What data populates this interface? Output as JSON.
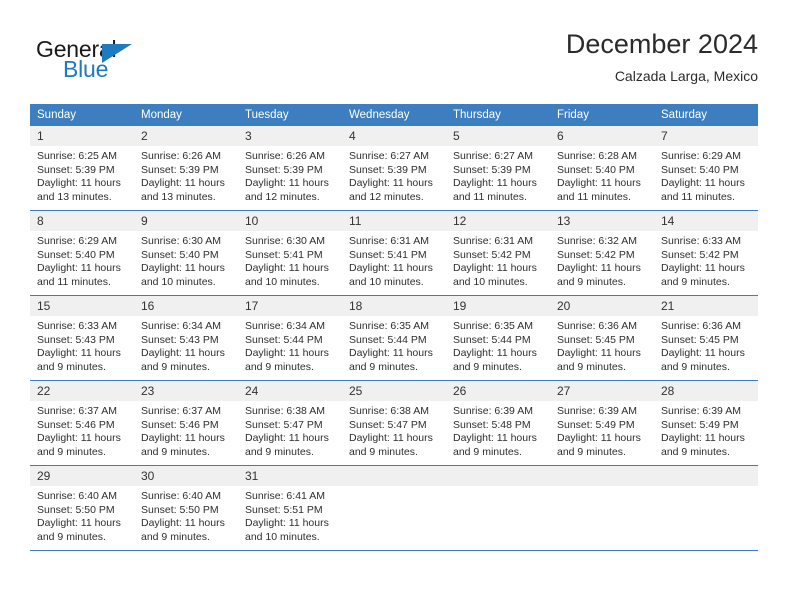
{
  "brand": {
    "name_part1": "General",
    "name_part2": "Blue",
    "triangle_icon": "triangle-icon",
    "accent_color": "#1f7ac0"
  },
  "header": {
    "title": "December 2024",
    "location": "Calzada Larga, Mexico"
  },
  "colors": {
    "header_blue": "#3c7ebf",
    "daynum_band": "#f0f0f0",
    "text": "#2e2e2e"
  },
  "weekday_headers": [
    "Sunday",
    "Monday",
    "Tuesday",
    "Wednesday",
    "Thursday",
    "Friday",
    "Saturday"
  ],
  "labels": {
    "sunrise_prefix": "Sunrise:",
    "sunset_prefix": "Sunset:",
    "daylight_prefix": "Daylight:"
  },
  "weeks": [
    [
      {
        "day": "1",
        "sunrise": "Sunrise: 6:25 AM",
        "sunset": "Sunset: 5:39 PM",
        "daylight_1": "Daylight: 11 hours",
        "daylight_2": "and 13 minutes."
      },
      {
        "day": "2",
        "sunrise": "Sunrise: 6:26 AM",
        "sunset": "Sunset: 5:39 PM",
        "daylight_1": "Daylight: 11 hours",
        "daylight_2": "and 13 minutes."
      },
      {
        "day": "3",
        "sunrise": "Sunrise: 6:26 AM",
        "sunset": "Sunset: 5:39 PM",
        "daylight_1": "Daylight: 11 hours",
        "daylight_2": "and 12 minutes."
      },
      {
        "day": "4",
        "sunrise": "Sunrise: 6:27 AM",
        "sunset": "Sunset: 5:39 PM",
        "daylight_1": "Daylight: 11 hours",
        "daylight_2": "and 12 minutes."
      },
      {
        "day": "5",
        "sunrise": "Sunrise: 6:27 AM",
        "sunset": "Sunset: 5:39 PM",
        "daylight_1": "Daylight: 11 hours",
        "daylight_2": "and 11 minutes."
      },
      {
        "day": "6",
        "sunrise": "Sunrise: 6:28 AM",
        "sunset": "Sunset: 5:40 PM",
        "daylight_1": "Daylight: 11 hours",
        "daylight_2": "and 11 minutes."
      },
      {
        "day": "7",
        "sunrise": "Sunrise: 6:29 AM",
        "sunset": "Sunset: 5:40 PM",
        "daylight_1": "Daylight: 11 hours",
        "daylight_2": "and 11 minutes."
      }
    ],
    [
      {
        "day": "8",
        "sunrise": "Sunrise: 6:29 AM",
        "sunset": "Sunset: 5:40 PM",
        "daylight_1": "Daylight: 11 hours",
        "daylight_2": "and 11 minutes."
      },
      {
        "day": "9",
        "sunrise": "Sunrise: 6:30 AM",
        "sunset": "Sunset: 5:40 PM",
        "daylight_1": "Daylight: 11 hours",
        "daylight_2": "and 10 minutes."
      },
      {
        "day": "10",
        "sunrise": "Sunrise: 6:30 AM",
        "sunset": "Sunset: 5:41 PM",
        "daylight_1": "Daylight: 11 hours",
        "daylight_2": "and 10 minutes."
      },
      {
        "day": "11",
        "sunrise": "Sunrise: 6:31 AM",
        "sunset": "Sunset: 5:41 PM",
        "daylight_1": "Daylight: 11 hours",
        "daylight_2": "and 10 minutes."
      },
      {
        "day": "12",
        "sunrise": "Sunrise: 6:31 AM",
        "sunset": "Sunset: 5:42 PM",
        "daylight_1": "Daylight: 11 hours",
        "daylight_2": "and 10 minutes."
      },
      {
        "day": "13",
        "sunrise": "Sunrise: 6:32 AM",
        "sunset": "Sunset: 5:42 PM",
        "daylight_1": "Daylight: 11 hours",
        "daylight_2": "and 9 minutes."
      },
      {
        "day": "14",
        "sunrise": "Sunrise: 6:33 AM",
        "sunset": "Sunset: 5:42 PM",
        "daylight_1": "Daylight: 11 hours",
        "daylight_2": "and 9 minutes."
      }
    ],
    [
      {
        "day": "15",
        "sunrise": "Sunrise: 6:33 AM",
        "sunset": "Sunset: 5:43 PM",
        "daylight_1": "Daylight: 11 hours",
        "daylight_2": "and 9 minutes."
      },
      {
        "day": "16",
        "sunrise": "Sunrise: 6:34 AM",
        "sunset": "Sunset: 5:43 PM",
        "daylight_1": "Daylight: 11 hours",
        "daylight_2": "and 9 minutes."
      },
      {
        "day": "17",
        "sunrise": "Sunrise: 6:34 AM",
        "sunset": "Sunset: 5:44 PM",
        "daylight_1": "Daylight: 11 hours",
        "daylight_2": "and 9 minutes."
      },
      {
        "day": "18",
        "sunrise": "Sunrise: 6:35 AM",
        "sunset": "Sunset: 5:44 PM",
        "daylight_1": "Daylight: 11 hours",
        "daylight_2": "and 9 minutes."
      },
      {
        "day": "19",
        "sunrise": "Sunrise: 6:35 AM",
        "sunset": "Sunset: 5:44 PM",
        "daylight_1": "Daylight: 11 hours",
        "daylight_2": "and 9 minutes."
      },
      {
        "day": "20",
        "sunrise": "Sunrise: 6:36 AM",
        "sunset": "Sunset: 5:45 PM",
        "daylight_1": "Daylight: 11 hours",
        "daylight_2": "and 9 minutes."
      },
      {
        "day": "21",
        "sunrise": "Sunrise: 6:36 AM",
        "sunset": "Sunset: 5:45 PM",
        "daylight_1": "Daylight: 11 hours",
        "daylight_2": "and 9 minutes."
      }
    ],
    [
      {
        "day": "22",
        "sunrise": "Sunrise: 6:37 AM",
        "sunset": "Sunset: 5:46 PM",
        "daylight_1": "Daylight: 11 hours",
        "daylight_2": "and 9 minutes."
      },
      {
        "day": "23",
        "sunrise": "Sunrise: 6:37 AM",
        "sunset": "Sunset: 5:46 PM",
        "daylight_1": "Daylight: 11 hours",
        "daylight_2": "and 9 minutes."
      },
      {
        "day": "24",
        "sunrise": "Sunrise: 6:38 AM",
        "sunset": "Sunset: 5:47 PM",
        "daylight_1": "Daylight: 11 hours",
        "daylight_2": "and 9 minutes."
      },
      {
        "day": "25",
        "sunrise": "Sunrise: 6:38 AM",
        "sunset": "Sunset: 5:47 PM",
        "daylight_1": "Daylight: 11 hours",
        "daylight_2": "and 9 minutes."
      },
      {
        "day": "26",
        "sunrise": "Sunrise: 6:39 AM",
        "sunset": "Sunset: 5:48 PM",
        "daylight_1": "Daylight: 11 hours",
        "daylight_2": "and 9 minutes."
      },
      {
        "day": "27",
        "sunrise": "Sunrise: 6:39 AM",
        "sunset": "Sunset: 5:49 PM",
        "daylight_1": "Daylight: 11 hours",
        "daylight_2": "and 9 minutes."
      },
      {
        "day": "28",
        "sunrise": "Sunrise: 6:39 AM",
        "sunset": "Sunset: 5:49 PM",
        "daylight_1": "Daylight: 11 hours",
        "daylight_2": "and 9 minutes."
      }
    ],
    [
      {
        "day": "29",
        "sunrise": "Sunrise: 6:40 AM",
        "sunset": "Sunset: 5:50 PM",
        "daylight_1": "Daylight: 11 hours",
        "daylight_2": "and 9 minutes."
      },
      {
        "day": "30",
        "sunrise": "Sunrise: 6:40 AM",
        "sunset": "Sunset: 5:50 PM",
        "daylight_1": "Daylight: 11 hours",
        "daylight_2": "and 9 minutes."
      },
      {
        "day": "31",
        "sunrise": "Sunrise: 6:41 AM",
        "sunset": "Sunset: 5:51 PM",
        "daylight_1": "Daylight: 11 hours",
        "daylight_2": "and 10 minutes."
      },
      {
        "day": "",
        "sunrise": "",
        "sunset": "",
        "daylight_1": "",
        "daylight_2": ""
      },
      {
        "day": "",
        "sunrise": "",
        "sunset": "",
        "daylight_1": "",
        "daylight_2": ""
      },
      {
        "day": "",
        "sunrise": "",
        "sunset": "",
        "daylight_1": "",
        "daylight_2": ""
      },
      {
        "day": "",
        "sunrise": "",
        "sunset": "",
        "daylight_1": "",
        "daylight_2": ""
      }
    ]
  ]
}
